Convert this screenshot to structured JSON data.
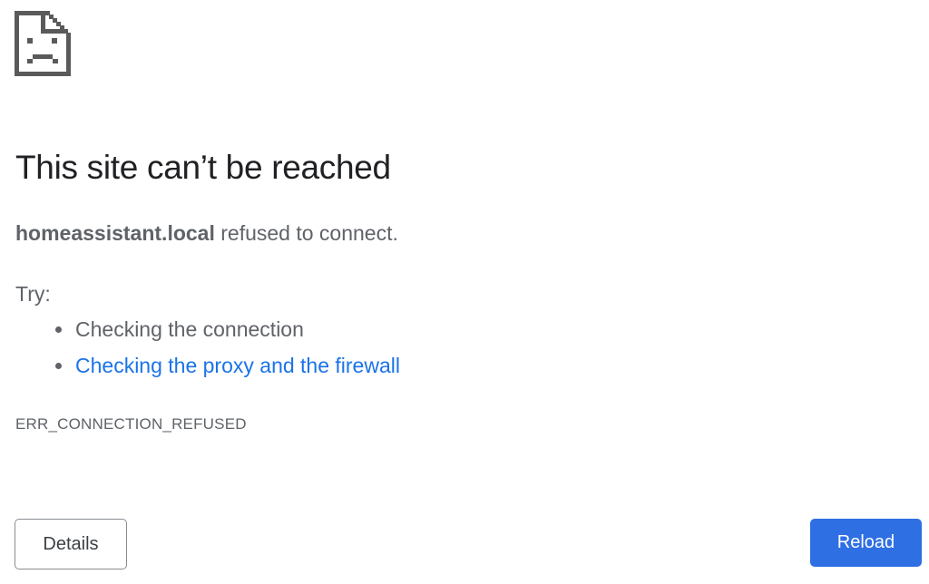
{
  "icon": "sad-page-icon",
  "title": "This site can’t be reached",
  "summary": {
    "host": "homeassistant.local",
    "message": " refused to connect."
  },
  "try_label": "Try:",
  "suggestions": [
    {
      "text": "Checking the connection",
      "is_link": false
    },
    {
      "text": "Checking the proxy and the firewall",
      "is_link": true
    }
  ],
  "error_code": "ERR_CONNECTION_REFUSED",
  "buttons": {
    "details": "Details",
    "reload": "Reload"
  },
  "colors": {
    "link": "#1a73e8",
    "reload_button": "#2f6fe4",
    "text_secondary": "#5f6368",
    "icon": "#5a5a5a"
  }
}
